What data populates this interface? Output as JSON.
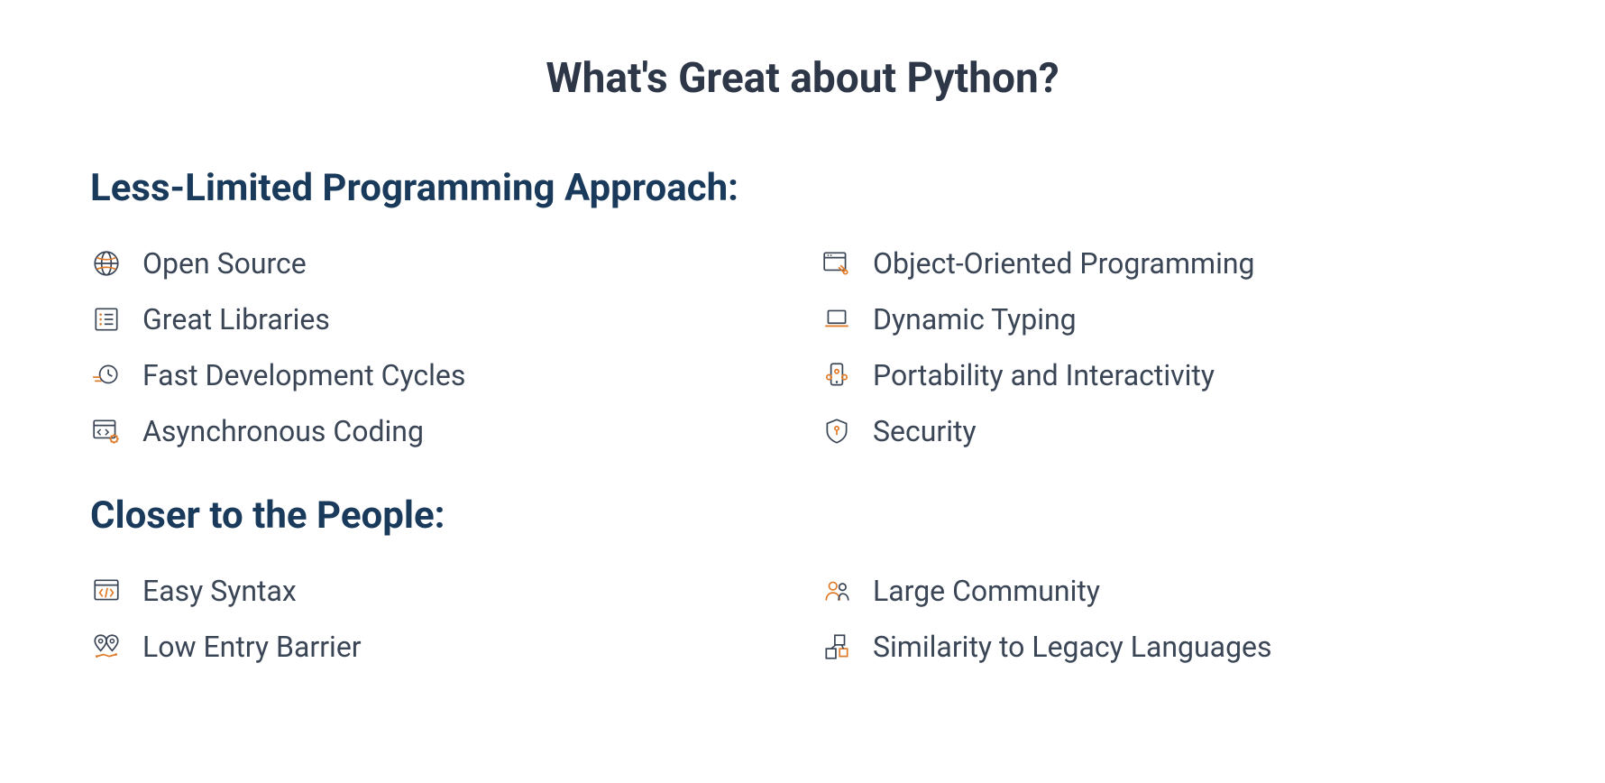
{
  "title": "What's Great about Python?",
  "sections": [
    {
      "heading": "Less-Limited Programming Approach:",
      "items": [
        {
          "label": "Open Source",
          "icon": "globe-icon"
        },
        {
          "label": "Object-Oriented Programming",
          "icon": "window-tool-icon"
        },
        {
          "label": "Great Libraries",
          "icon": "list-box-icon"
        },
        {
          "label": "Dynamic Typing",
          "icon": "laptop-icon"
        },
        {
          "label": "Fast Development Cycles",
          "icon": "clock-fast-icon"
        },
        {
          "label": "Portability and Interactivity",
          "icon": "portable-device-icon"
        },
        {
          "label": "Asynchronous Coding",
          "icon": "code-gear-icon"
        },
        {
          "label": "Security",
          "icon": "shield-icon"
        }
      ]
    },
    {
      "heading": "Closer to the People:",
      "items": [
        {
          "label": "Easy Syntax",
          "icon": "code-window-icon"
        },
        {
          "label": "Large Community",
          "icon": "people-icon"
        },
        {
          "label": "Low Entry Barrier",
          "icon": "map-pins-icon"
        },
        {
          "label": "Similarity to Legacy Languages",
          "icon": "blocks-icon"
        }
      ]
    }
  ],
  "colors": {
    "dark": "#3a4556",
    "orange": "#e07b2a"
  }
}
